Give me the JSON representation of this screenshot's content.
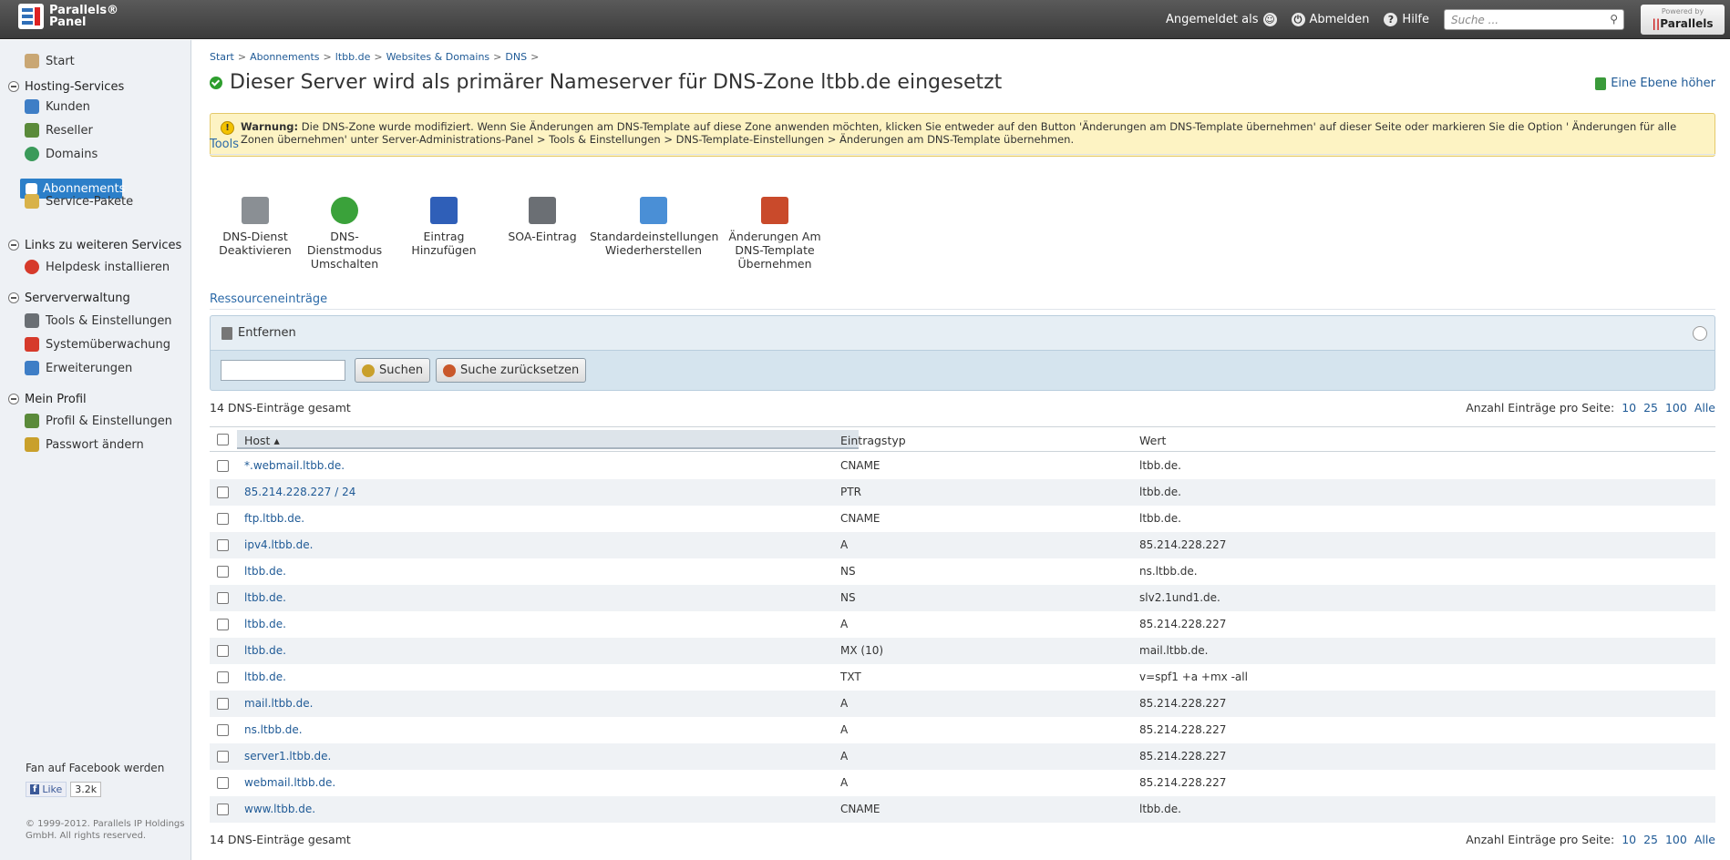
{
  "topbar": {
    "logo_line1": "Parallels®",
    "logo_line2": "Panel",
    "logged_in": "Angemeldet als",
    "logout": "Abmelden",
    "help": "Hilfe",
    "search_placeholder": "Suche ...",
    "powered_by": "Powered by",
    "powered_brand": "Parallels"
  },
  "sidebar": {
    "start": "Start",
    "groups": [
      {
        "label": "Hosting-Services",
        "items": [
          "Kunden",
          "Reseller",
          "Domains",
          "Abonnements",
          "Service-Pakete"
        ]
      },
      {
        "label": "Links zu weiteren Services",
        "items": [
          "Helpdesk installieren"
        ]
      },
      {
        "label": "Serververwaltung",
        "items": [
          "Tools & Einstellungen",
          "Systemüberwachung",
          "Erweiterungen"
        ]
      },
      {
        "label": "Mein Profil",
        "items": [
          "Profil & Einstellungen",
          "Passwort ändern"
        ]
      }
    ],
    "facebook": "Fan auf Facebook werden",
    "like": "Like",
    "like_count": "3.2k",
    "copyright": "© 1999-2012. Parallels IP Holdings GmbH. All rights reserved."
  },
  "breadcrumb": [
    "Start",
    "Abonnements",
    "ltbb.de",
    "Websites & Domains",
    "DNS"
  ],
  "title": "Dieser Server wird als primärer Nameserver für DNS-Zone ltbb.de eingesetzt",
  "up_level": "Eine Ebene höher",
  "warning": {
    "label": "Warnung:",
    "text": "Die DNS-Zone wurde modifiziert. Wenn Sie Änderungen am DNS-Template auf diese Zone anwenden möchten, klicken Sie entweder auf den Button 'Änderungen am DNS-Template übernehmen' auf dieser Seite oder markieren Sie die Option ' Änderungen für alle Zonen übernehmen' unter Server-Administrations-Panel > Tools & Einstellungen > DNS-Template-Einstellungen > Änderungen am DNS-Template übernehmen."
  },
  "tools_heading": "Tools",
  "tools": [
    {
      "line1": "DNS-Dienst",
      "line2": "Deaktivieren",
      "line3": "",
      "color": "#8a8f94"
    },
    {
      "line1": "DNS-Dienstmodus",
      "line2": "Umschalten",
      "line3": "",
      "color": "#3aa23a"
    },
    {
      "line1": "Eintrag",
      "line2": "Hinzufügen",
      "line3": "",
      "color": "#2f5fb8"
    },
    {
      "line1": "SOA-Eintrag",
      "line2": "",
      "line3": "",
      "color": "#6b6f74"
    },
    {
      "line1": "Standardeinstellungen",
      "line2": "Wiederherstellen",
      "line3": "",
      "color": "#4a8fd6"
    },
    {
      "line1": "Änderungen Am",
      "line2": "DNS-Template",
      "line3": "Übernehmen",
      "color": "#c94a2b"
    }
  ],
  "resources_heading": "Ressourceneinträge",
  "remove": "Entfernen",
  "search_button": "Suchen",
  "reset_button": "Suche zurücksetzen",
  "total": "14 DNS-Einträge gesamt",
  "per_page_label": "Anzahl Einträge pro Seite:",
  "per_page_options": [
    "10",
    "25",
    "100",
    "Alle"
  ],
  "columns": {
    "host": "Host",
    "type": "Eintragstyp",
    "value": "Wert"
  },
  "records": [
    {
      "host": "*.webmail.ltbb.de.",
      "type": "CNAME",
      "value": "ltbb.de."
    },
    {
      "host": "85.214.228.227 / 24",
      "type": "PTR",
      "value": "ltbb.de."
    },
    {
      "host": "ftp.ltbb.de.",
      "type": "CNAME",
      "value": "ltbb.de."
    },
    {
      "host": "ipv4.ltbb.de.",
      "type": "A",
      "value": "85.214.228.227"
    },
    {
      "host": "ltbb.de.",
      "type": "NS",
      "value": "ns.ltbb.de."
    },
    {
      "host": "ltbb.de.",
      "type": "NS",
      "value": "slv2.1und1.de."
    },
    {
      "host": "ltbb.de.",
      "type": "A",
      "value": "85.214.228.227"
    },
    {
      "host": "ltbb.de.",
      "type": "MX (10)",
      "value": "mail.ltbb.de."
    },
    {
      "host": "ltbb.de.",
      "type": "TXT",
      "value": "v=spf1 +a +mx -all"
    },
    {
      "host": "mail.ltbb.de.",
      "type": "A",
      "value": "85.214.228.227"
    },
    {
      "host": "ns.ltbb.de.",
      "type": "A",
      "value": "85.214.228.227"
    },
    {
      "host": "server1.ltbb.de.",
      "type": "A",
      "value": "85.214.228.227"
    },
    {
      "host": "webmail.ltbb.de.",
      "type": "A",
      "value": "85.214.228.227"
    },
    {
      "host": "www.ltbb.de.",
      "type": "CNAME",
      "value": "ltbb.de."
    }
  ]
}
